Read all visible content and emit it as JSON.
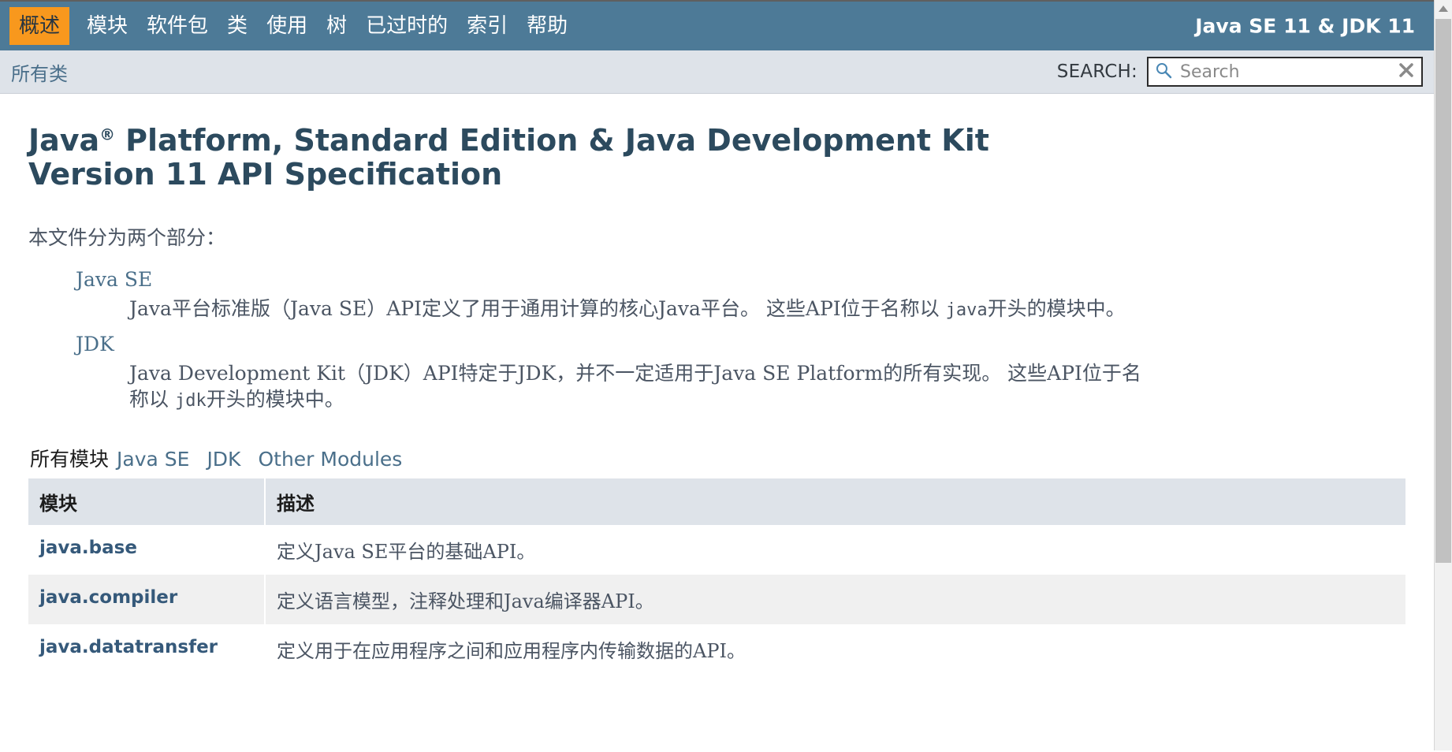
{
  "topnav": {
    "items": [
      {
        "label": "概述",
        "active": true
      },
      {
        "label": "模块",
        "active": false
      },
      {
        "label": "软件包",
        "active": false
      },
      {
        "label": "类",
        "active": false
      },
      {
        "label": "使用",
        "active": false
      },
      {
        "label": "树",
        "active": false
      },
      {
        "label": "已过时的",
        "active": false
      },
      {
        "label": "索引",
        "active": false
      },
      {
        "label": "帮助",
        "active": false
      }
    ],
    "title": "Java SE 11 & JDK 11",
    "background_color": "#4d7a97",
    "active_color": "#f8981d"
  },
  "subnav": {
    "all_classes_label": "所有类",
    "search_label": "SEARCH:",
    "search_placeholder": "Search",
    "search_value": "",
    "search_icon": "magnifier-icon",
    "clear_icon": "close-icon",
    "background_color": "#dee3e9"
  },
  "main": {
    "title_part1": "Java",
    "title_sup": "®",
    "title_part2": " Platform, Standard Edition & Java Development Kit Version 11 API Specification",
    "intro": "本文件分为两个部分：",
    "definitions": [
      {
        "term": "Java SE",
        "desc_before": "Java平台标准版（Java SE）API定义了用于通用计算的核心Java平台。 这些API位于名称以 ",
        "desc_code": "java",
        "desc_after": "开头的模块中。"
      },
      {
        "term": "JDK",
        "desc_before": "Java Development Kit（JDK）API特定于JDK，并不一定适用于Java SE Platform的所有实现。 这些API位于名称以 ",
        "desc_code": "jdk",
        "desc_after": "开头的模块中。"
      }
    ],
    "tabs": [
      {
        "label": "所有模块",
        "active": true
      },
      {
        "label": "Java SE",
        "active": false
      },
      {
        "label": "JDK",
        "active": false
      },
      {
        "label": "Other Modules",
        "active": false
      }
    ],
    "table": {
      "headers": [
        "模块",
        "描述"
      ],
      "rows": [
        {
          "module": "java.base",
          "description": "定义Java SE平台的基础API。"
        },
        {
          "module": "java.compiler",
          "description": "定义语言模型，注释处理和Java编译器API。"
        },
        {
          "module": "java.datatransfer",
          "description": "定义用于在应用程序之间和应用程序内传输数据的API。"
        }
      ]
    }
  },
  "scrollbar": {
    "up_arrow_icon": "triangle-up-icon"
  },
  "colors": {
    "header_blue": "#4d7a97",
    "accent_orange": "#f8981d",
    "link_blue": "#4a6f8a",
    "title_navy": "#2c4a5e"
  }
}
